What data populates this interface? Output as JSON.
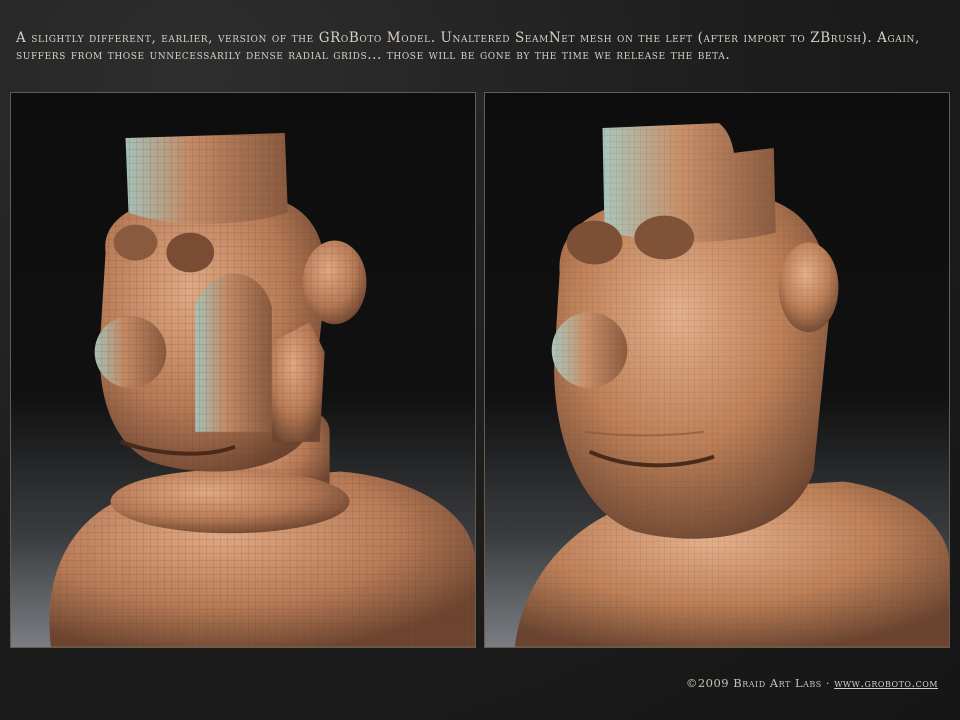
{
  "caption": "A slightly different, earlier, version of the GRoBoto Model. Unaltered SeamNet mesh on the left (after import to ZBrush). Again, suffers from those unnecessarily dense radial grids... those will be gone by the time we release the beta.",
  "footer": {
    "copyright": "©2009 Braid Art Labs · ",
    "link_text": "www.groboto.com"
  },
  "colors": {
    "background": "#1f1f1f",
    "caption_text": "#d8d0c4",
    "panel_border": "#6a5a48",
    "model_skin": "#c48a66"
  },
  "images": {
    "left": "unaltered-seamnet-mesh-render",
    "right": "zbrush-smoothed-mesh-render"
  }
}
